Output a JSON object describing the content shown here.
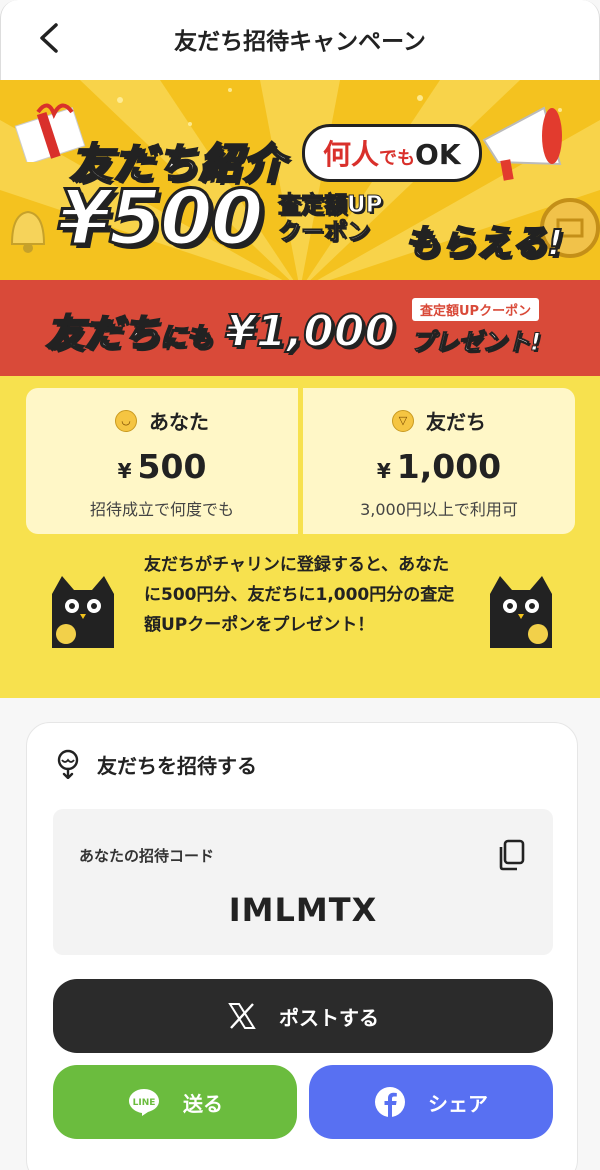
{
  "header": {
    "title": "友だち招待キャンペーン"
  },
  "banner": {
    "headline": "友だち紹介",
    "badge_prefix": "何人",
    "badge_mid": "でも",
    "badge_suffix": "OK",
    "amount": "¥500",
    "sub_line1": "査定額UP",
    "sub_line2": "クーポン",
    "tail": "もらえる!",
    "red_part1": "友だち",
    "red_part2": "にも",
    "red_amount": "¥1,000",
    "red_badge": "査定額UPクーポン",
    "red_present": "プレゼント!"
  },
  "rewards": [
    {
      "label": "あなた",
      "currency": "¥",
      "amount": "500",
      "note": "招待成立で何度でも"
    },
    {
      "label": "友だち",
      "currency": "¥",
      "amount": "1,000",
      "note": "3,000円以上で利用可"
    }
  ],
  "description": "友だちがチャリンに登録すると、あなたに500円分、友だちに1,000円分の査定額UPクーポンをプレゼント！",
  "invite": {
    "heading": "友だちを招待する",
    "code_label": "あなたの招待コード",
    "code": "IMLMTX"
  },
  "buttons": {
    "post": "ポストする",
    "line": "送る",
    "share": "シェア"
  },
  "colors": {
    "banner_yellow": "#f4c21f",
    "red_strip": "#d94a39",
    "section_yellow": "#f7e14e",
    "line_green": "#6bbc3e",
    "facebook_blue": "#5870f2",
    "x_dark": "#2b2b2b"
  }
}
